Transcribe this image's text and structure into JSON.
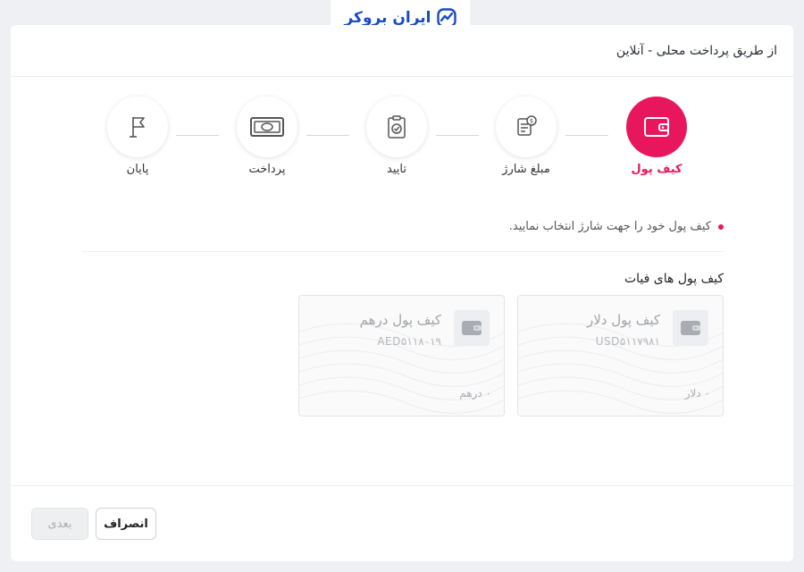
{
  "brand": {
    "logo_text": "ایران بروکر",
    "color": "#1a4bc4"
  },
  "header": {
    "title": "از طریق پرداخت محلی - آنلاین"
  },
  "steps": [
    {
      "label": "کیف پول",
      "icon": "wallet-icon",
      "active": true
    },
    {
      "label": "مبلغ شارژ",
      "icon": "invoice-icon",
      "active": false
    },
    {
      "label": "تایید",
      "icon": "clipboard-check-icon",
      "active": false
    },
    {
      "label": "پرداخت",
      "icon": "banknote-icon",
      "active": false
    },
    {
      "label": "پایان",
      "icon": "flag-icon",
      "active": false
    }
  ],
  "accent_color": "#e8175d",
  "hint": {
    "text": "کیف پول خود را جهت شارژ انتخاب نمایید."
  },
  "fiat_section": {
    "title": "کیف پول های فیات"
  },
  "wallets": [
    {
      "name": "کیف پول دلار",
      "code": "USD۵۱۱۷۹۸۱",
      "balance": "۰ دلار"
    },
    {
      "name": "کیف پول درهم",
      "code": "AED۵۱۱۸۰۱۹",
      "balance": "۰ درهم"
    }
  ],
  "footer": {
    "cancel_label": "انصراف",
    "next_label": "بعدی"
  }
}
